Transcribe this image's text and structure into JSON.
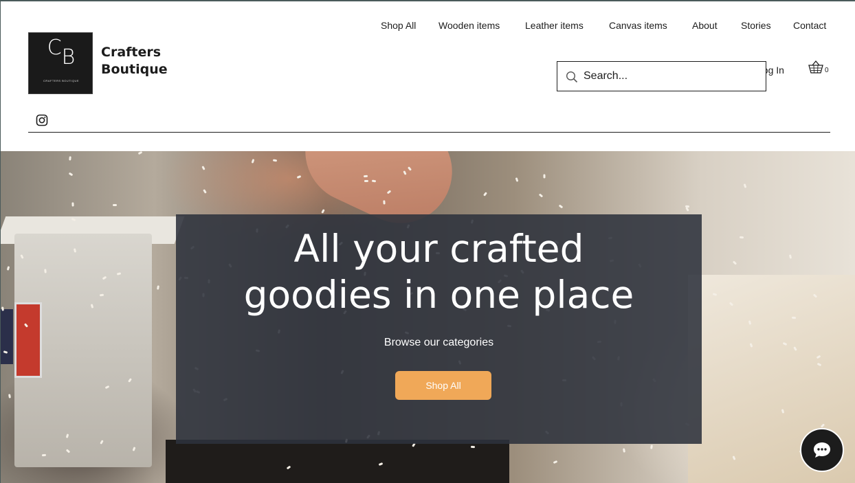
{
  "brand": {
    "logo_letters_c": "C",
    "logo_letters_b": "B",
    "logo_tagline": "CRAFTERS BOUTIQUE",
    "name_line1": "Crafters",
    "name_line2": "Boutique"
  },
  "nav": {
    "items": [
      {
        "label": "Shop All"
      },
      {
        "label": "Wooden items"
      },
      {
        "label": "Leather items"
      },
      {
        "label": "Canvas items"
      },
      {
        "label": "About"
      },
      {
        "label": "Stories"
      },
      {
        "label": "Contact"
      }
    ]
  },
  "search": {
    "placeholder": "Search..."
  },
  "account": {
    "login_label": "Log In",
    "cart_count": "0"
  },
  "hero": {
    "title_line1": "All your crafted",
    "title_line2": "goodies in one place",
    "subtitle": "Browse our categories",
    "button_label": "Shop All"
  },
  "colors": {
    "accent": "#f0a858",
    "overlay": "#2e323c",
    "text": "#1c1c1c"
  },
  "icons": {
    "search": "search-icon",
    "cart": "cart-icon",
    "social": "instagram-icon",
    "chat": "chat-icon"
  }
}
